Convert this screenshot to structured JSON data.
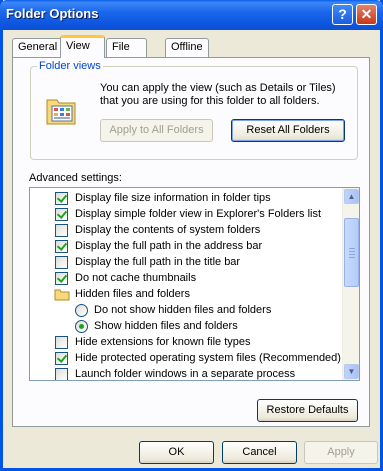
{
  "window": {
    "title": "Folder Options",
    "help_glyph": "?",
    "close_glyph": "✕"
  },
  "tabs": [
    "General",
    "View",
    "File Types",
    "Offline Files"
  ],
  "folder_views": {
    "title": "Folder views",
    "description": "You can apply the view (such as Details or Tiles) that you are using for this folder to all folders.",
    "apply_all_label": "Apply to All Folders",
    "reset_all_label": "Reset All Folders"
  },
  "advanced": {
    "label": "Advanced settings:",
    "items": [
      {
        "type": "checkbox",
        "checked": true,
        "label": "Display file size information in folder tips"
      },
      {
        "type": "checkbox",
        "checked": true,
        "label": "Display simple folder view in Explorer's Folders list"
      },
      {
        "type": "checkbox",
        "checked": false,
        "label": "Display the contents of system folders"
      },
      {
        "type": "checkbox",
        "checked": true,
        "label": "Display the full path in the address bar"
      },
      {
        "type": "checkbox",
        "checked": false,
        "label": "Display the full path in the title bar"
      },
      {
        "type": "checkbox",
        "checked": true,
        "label": "Do not cache thumbnails"
      },
      {
        "type": "folder",
        "label": "Hidden files and folders"
      },
      {
        "type": "radio",
        "checked": false,
        "label": "Do not show hidden files and folders"
      },
      {
        "type": "radio",
        "checked": true,
        "label": "Show hidden files and folders"
      },
      {
        "type": "checkbox",
        "checked": false,
        "label": "Hide extensions for known file types"
      },
      {
        "type": "checkbox",
        "checked": true,
        "label": "Hide protected operating system files (Recommended)"
      },
      {
        "type": "checkbox",
        "checked": false,
        "label": "Launch folder windows in a separate process"
      }
    ],
    "scroll_up_glyph": "▲",
    "scroll_down_glyph": "▼"
  },
  "restore_defaults_label": "Restore Defaults",
  "footer": {
    "ok_label": "OK",
    "cancel_label": "Cancel",
    "apply_label": "Apply"
  }
}
